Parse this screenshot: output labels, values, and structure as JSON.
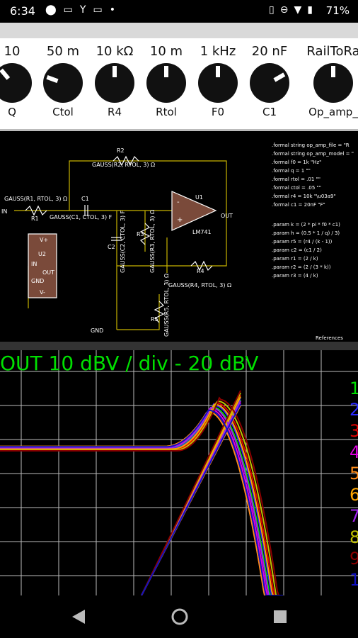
{
  "status_bar": {
    "time": "6:34",
    "left_icons": [
      "location-icon",
      "sim-icon",
      "y-icon",
      "sim-icon",
      "dot-icon"
    ],
    "right_icons": [
      "vibrate-icon",
      "dnd-icon",
      "wifi-icon",
      "battery-icon"
    ],
    "battery": "71%"
  },
  "knobs": [
    {
      "value": "10",
      "label": "Q",
      "angle": -40
    },
    {
      "value": "50 m",
      "label": "Ctol",
      "angle": -70
    },
    {
      "value": "10 kΩ",
      "label": "R4",
      "angle": 0
    },
    {
      "value": "10 m",
      "label": "Rtol",
      "angle": 0
    },
    {
      "value": "1 kHz",
      "label": "F0",
      "angle": 0
    },
    {
      "value": "20 nF",
      "label": "C1",
      "angle": 60
    },
    {
      "value": "RailToRa",
      "label": "Op_amp_",
      "angle": 0
    }
  ],
  "schematic": {
    "r2_label": "R2",
    "r2_gauss": "GAUSS(R2, RTOL, 3) Ω",
    "in_gauss": "GAUSS(R1, RTOL, 3) Ω",
    "in_label": "IN",
    "r1_label": "R1",
    "c1_label": "C1",
    "c1_gauss": "GAUSS(C1, CTOL, 3) F",
    "c2_label": "C2",
    "c2_gauss": "GAUSS(C2, CTOL, 3) F",
    "r3_label": "R3",
    "r3_gauss": "GAUSS(R3, RTOL, 3) Ω",
    "u1_label": "U1",
    "u1_part": "LM741",
    "u2_label": "U2",
    "out_label": "OUT",
    "r4_label": "R4",
    "r4_gauss": "GAUSS(R4, RTOL, 3) Ω",
    "r5_label": "R5",
    "r5_gauss": "GAUSS(R5, RTOL, 3) Ω",
    "gnd_label": "GND",
    "u2_pins": {
      "in": "IN",
      "gnd": "GND",
      "out": "OUT",
      "vp": "V+",
      "vm": "V-"
    },
    "directives": [
      ".formal string op_amp_file = \"R",
      ".formal string op_amp_model = \"",
      ".formal f0 = 1k \"Hz\"",
      ".formal q = 1 \"\"",
      ".formal rtol = .01 \"\"",
      ".formal ctol = .05 \"\"",
      ".formal r4 = 10k \"\\u03a9\"",
      ".formal c1 = 20nF \"F\"",
      "",
      ".param k = (2 * pi * f0 * c1)",
      ".param h = (0.5 * 1 / q) / 3)",
      ".param r5 = (r4 / (k - 1))",
      ".param c2 = (c1 / 2)",
      ".param r1 = (2 / k)",
      ".param r2 = (2 / (3 * k))",
      ".param r3 = (4 / k)"
    ],
    "references": "References"
  },
  "scope": {
    "title": "OUT   10 dBV / div - 20 dBV",
    "legend": [
      {
        "n": "1",
        "color": "#00e000"
      },
      {
        "n": "2",
        "color": "#2a2aff"
      },
      {
        "n": "3",
        "color": "#e00000"
      },
      {
        "n": "4",
        "color": "#e000e0"
      },
      {
        "n": "5",
        "color": "#ff8c1a"
      },
      {
        "n": "6",
        "color": "#ffa500"
      },
      {
        "n": "7",
        "color": "#a020f0"
      },
      {
        "n": "8",
        "color": "#c0c000"
      },
      {
        "n": "9",
        "color": "#8b0000"
      },
      {
        "n": "10",
        "color": "#1010c0"
      }
    ],
    "traces": [
      {
        "color": "#00e000",
        "peak": 0.0
      },
      {
        "color": "#2a2aff",
        "peak": 0.6
      },
      {
        "color": "#e00000",
        "peak": 1.4
      },
      {
        "color": "#e000e0",
        "peak": -0.8
      },
      {
        "color": "#ff8c1a",
        "peak": -1.6
      },
      {
        "color": "#ffa500",
        "peak": 0.9
      },
      {
        "color": "#a020f0",
        "peak": -0.3
      },
      {
        "color": "#c0c000",
        "peak": 2.0
      },
      {
        "color": "#8b0000",
        "peak": 2.6
      },
      {
        "color": "#1010c0",
        "peak": -1.2
      }
    ]
  },
  "nav": {
    "back": "back-icon",
    "home": "home-icon",
    "recents": "recents-icon"
  }
}
